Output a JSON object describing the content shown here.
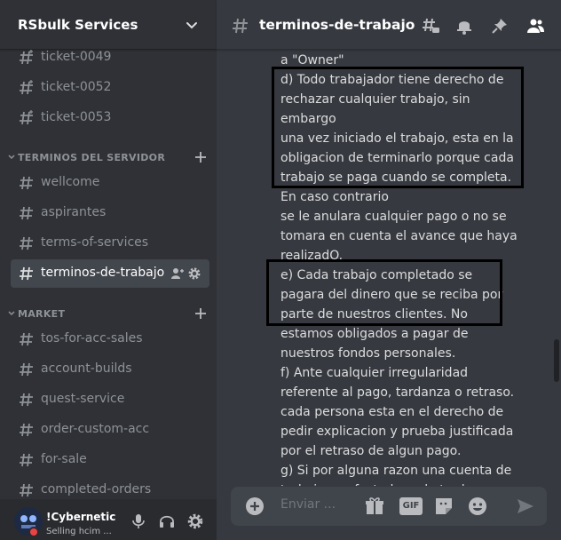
{
  "server": {
    "name": "RSbulk Services"
  },
  "channels_top": [
    {
      "label": "ticket-0049"
    },
    {
      "label": "ticket-0052"
    },
    {
      "label": "ticket-0053"
    }
  ],
  "categories": {
    "terminos": {
      "label": "TERMINOS DEL SERVIDOR"
    },
    "market": {
      "label": "MARKET"
    }
  },
  "channels_terminos": [
    {
      "label": "wellcome"
    },
    {
      "label": "aspirantes"
    },
    {
      "label": "terms-of-services"
    },
    {
      "label": "terminos-de-trabajo",
      "selected": true
    }
  ],
  "channels_market": [
    {
      "label": "tos-for-acc-sales"
    },
    {
      "label": "account-builds"
    },
    {
      "label": "quest-service"
    },
    {
      "label": "order-custom-acc"
    },
    {
      "label": "for-sale"
    },
    {
      "label": "completed-orders"
    }
  ],
  "user": {
    "name": "!Cybernetic",
    "status": "Selling hcim ..."
  },
  "topbar": {
    "title": "terminos-de-trabajo"
  },
  "message_lines": [
    "a \"Owner\"",
    "d) Todo trabajador tiene derecho de",
    "rechazar cualquier trabajo, sin",
    "embargo",
    "una vez iniciado el trabajo, esta en la",
    "obligacion de terminarlo porque cada",
    "trabajo se paga cuando se completa.",
    "En caso contrario",
    "se le anulara cualquier pago o no se",
    "tomara en cuenta el avance que haya",
    "realizadO.",
    "e)  Cada trabajo completado se",
    "pagara del dinero que se reciba por",
    "parte de nuestros clientes. No",
    "estamos obligados a pagar de",
    "nuestros fondos personales.",
    "f) Ante cualquier irregularidad",
    "referente al pago, tardanza o retraso.",
    "cada persona esta en el derecho de",
    "pedir explicacion y prueba justificada",
    "por el retraso de algun pago.",
    "g) Si por alguna razon una cuenta de",
    "trabajo es afectada en la tarde"
  ],
  "composer": {
    "placeholder": "Enviar ...",
    "gif_label": "GIF"
  },
  "colors": {
    "sidebar": "#2f3136",
    "main": "#36393f",
    "composer": "#40444b",
    "status_dnd": "#ed4245"
  },
  "icons": [
    "chevron-down-icon",
    "hash-icon",
    "threads-icon",
    "bell-icon",
    "pin-icon",
    "members-icon",
    "add-member-icon",
    "gear-icon",
    "plus-icon",
    "mic-icon",
    "headphones-icon",
    "add-circle-icon",
    "gift-icon",
    "sticker-icon",
    "emoji-icon",
    "send-icon"
  ]
}
